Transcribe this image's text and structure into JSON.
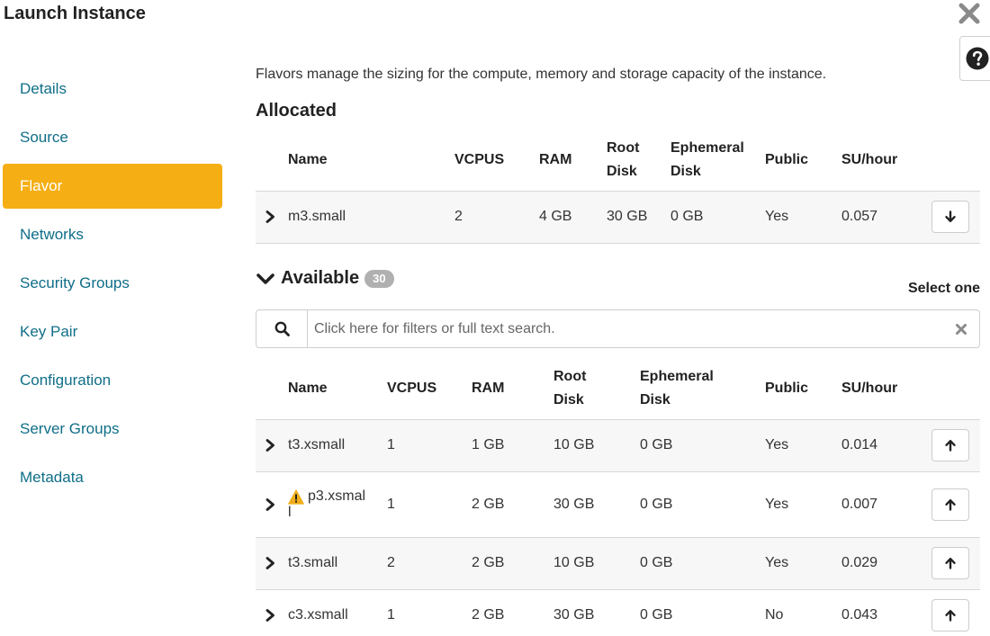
{
  "window": {
    "title": "Launch Instance"
  },
  "sidebar": {
    "items": [
      {
        "label": "Details",
        "active": false
      },
      {
        "label": "Source",
        "active": false
      },
      {
        "label": "Flavor",
        "active": true
      },
      {
        "label": "Networks",
        "active": false
      },
      {
        "label": "Security Groups",
        "active": false
      },
      {
        "label": "Key Pair",
        "active": false
      },
      {
        "label": "Configuration",
        "active": false
      },
      {
        "label": "Server Groups",
        "active": false
      },
      {
        "label": "Metadata",
        "active": false
      }
    ]
  },
  "main": {
    "description": "Flavors manage the sizing for the compute, memory and storage capacity of the instance.",
    "allocated": {
      "heading": "Allocated",
      "columns": {
        "name": "Name",
        "vcpus": "VCPUS",
        "ram": "RAM",
        "root_disk_1": "Root",
        "root_disk_2": "Disk",
        "ephemeral_1": "Ephemeral",
        "ephemeral_2": "Disk",
        "public": "Public",
        "su_hour": "SU/hour"
      },
      "rows": [
        {
          "name": "m3.small",
          "vcpus": "2",
          "ram": "4 GB",
          "root_disk": "30 GB",
          "ephemeral": "0 GB",
          "public": "Yes",
          "su_hour": "0.057"
        }
      ]
    },
    "available": {
      "heading": "Available",
      "count": "30",
      "select_hint": "Select one",
      "search_placeholder": "Click here for filters or full text search.",
      "columns": {
        "name": "Name",
        "vcpus": "VCPUS",
        "ram": "RAM",
        "root_disk_1": "Root",
        "root_disk_2": "Disk",
        "ephemeral_1": "Ephemeral",
        "ephemeral_2": "Disk",
        "public": "Public",
        "su_hour": "SU/hour"
      },
      "rows": [
        {
          "name": "t3.xsmall",
          "name_line2": "",
          "warning": false,
          "vcpus": "1",
          "ram": "1 GB",
          "root_disk": "10 GB",
          "ephemeral": "0 GB",
          "public": "Yes",
          "su_hour": "0.014"
        },
        {
          "name": "p3.xsmal",
          "name_line2": "l",
          "warning": true,
          "vcpus": "1",
          "ram": "2 GB",
          "root_disk": "30 GB",
          "ephemeral": "0 GB",
          "public": "Yes",
          "su_hour": "0.007"
        },
        {
          "name": "t3.small",
          "name_line2": "",
          "warning": false,
          "vcpus": "2",
          "ram": "2 GB",
          "root_disk": "10 GB",
          "ephemeral": "0 GB",
          "public": "Yes",
          "su_hour": "0.029"
        },
        {
          "name": "c3.xsmall",
          "name_line2": "",
          "warning": false,
          "vcpus": "1",
          "ram": "2 GB",
          "root_disk": "30 GB",
          "ephemeral": "0 GB",
          "public": "No",
          "su_hour": "0.043"
        }
      ]
    }
  },
  "colors": {
    "accent": "#f5ae14",
    "link": "#0f6e88",
    "warning": "#f0ad1a"
  },
  "icons": {
    "close": "close-icon",
    "help": "help-icon",
    "expand": "chevron-right-icon",
    "collapse": "chevron-down-icon",
    "search": "search-icon",
    "clear": "clear-icon",
    "deallocate": "arrow-down-icon",
    "allocate": "arrow-up-icon",
    "warning": "warning-icon"
  }
}
